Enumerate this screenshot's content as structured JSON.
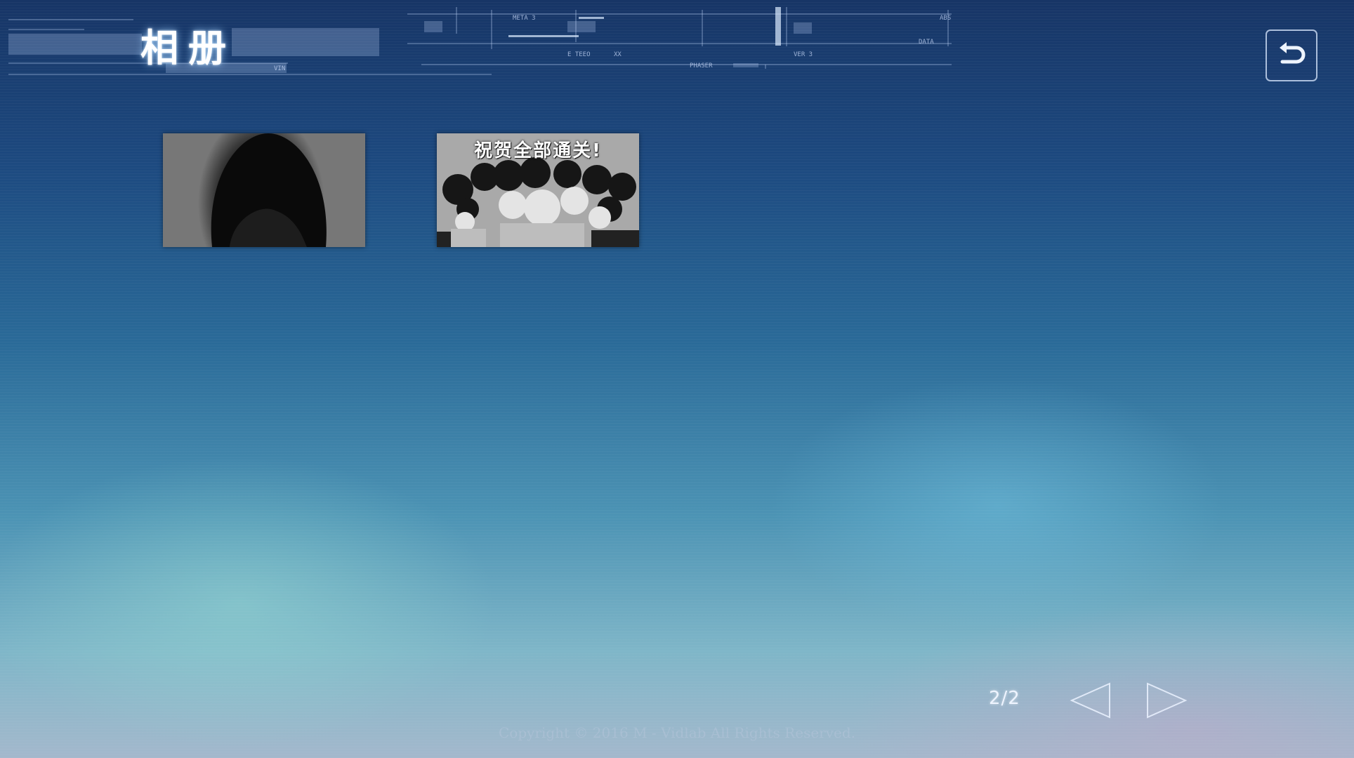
{
  "screen": {
    "title": "相册",
    "back_icon": "undo-arrow-icon"
  },
  "hud": {
    "labels": [
      "DATA",
      "PHASER",
      "VIN",
      "ABS",
      "E TEEO",
      "META 3",
      "VER 3",
      "XX"
    ]
  },
  "gallery": {
    "items": [
      {
        "name": "cg-dark-silhouette",
        "caption": ""
      },
      {
        "name": "cg-congratulations-group",
        "caption": "祝贺全部通关!"
      }
    ]
  },
  "pagination": {
    "indicator": "2/2",
    "prev_icon": "triangle-left-icon",
    "next_icon": "triangle-right-icon"
  },
  "footer": {
    "copyright": "Copyright © 2016 M - Vidlab All Rights Reserved."
  }
}
